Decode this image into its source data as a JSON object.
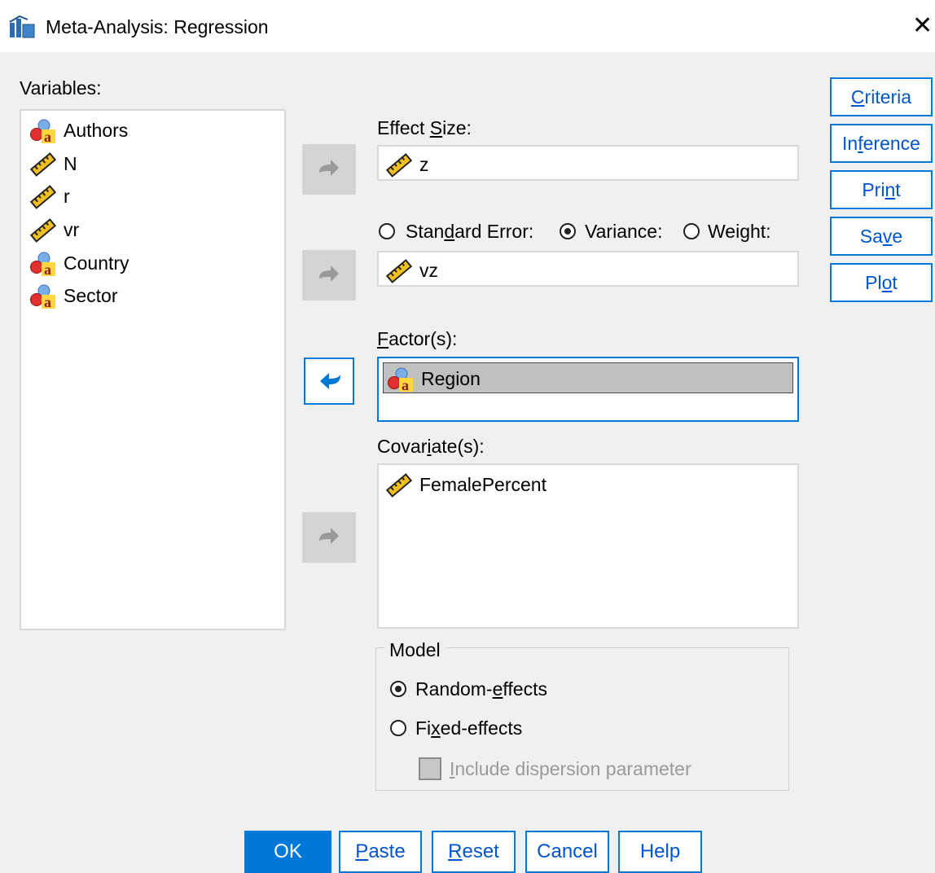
{
  "window": {
    "title": "Meta-Analysis: Regression"
  },
  "variables": {
    "label": "Variables:",
    "items": [
      {
        "name": "Authors",
        "icon": "nominal-string-icon"
      },
      {
        "name": "N",
        "icon": "scale-ruler-icon"
      },
      {
        "name": "r",
        "icon": "scale-ruler-icon"
      },
      {
        "name": "vr",
        "icon": "scale-ruler-icon"
      },
      {
        "name": "Country",
        "icon": "nominal-string-icon"
      },
      {
        "name": "Sector",
        "icon": "nominal-string-icon"
      }
    ]
  },
  "effect_size": {
    "label_pre": "Effect ",
    "label_key": "S",
    "label_post": "ize:",
    "value": "z"
  },
  "weight_type": {
    "se_pre": "Stan",
    "se_key": "d",
    "se_post": "ard Error:",
    "variance": "Variance:",
    "weight": "Weight:",
    "selected": "Variance",
    "value": "vz"
  },
  "factors": {
    "label_key": "F",
    "label_post": "actor(s):",
    "items": [
      "Region"
    ]
  },
  "covariates": {
    "label_pre": "Covar",
    "label_key": "i",
    "label_post": "ate(s):",
    "items": [
      "FemalePercent"
    ]
  },
  "model": {
    "label": "Model",
    "random_pre": "Random-",
    "random_key": "e",
    "random_post": "ffects",
    "fixed_pre": "Fi",
    "fixed_key": "x",
    "fixed_post": "ed-effects",
    "selected": "Random-effects",
    "dispersion_key": "I",
    "dispersion_post": "nclude dispersion parameter"
  },
  "side_buttons": {
    "criteria_key": "C",
    "criteria_post": "riteria",
    "inference_pre": "In",
    "inference_key": "f",
    "inference_post": "erence",
    "print_pre": "Pri",
    "print_key": "n",
    "print_post": "t",
    "save_pre": "Sa",
    "save_key": "v",
    "save_post": "e",
    "plot_pre": "Pl",
    "plot_key": "o",
    "plot_post": "t"
  },
  "bottom_buttons": {
    "ok": "OK",
    "paste_key": "P",
    "paste_post": "aste",
    "reset_key": "R",
    "reset_post": "eset",
    "cancel": "Cancel",
    "help": "Help"
  },
  "colors": {
    "accent": "#0078d7",
    "selection": "#c0c0c0",
    "dialog_bg": "#f0f0f0"
  }
}
